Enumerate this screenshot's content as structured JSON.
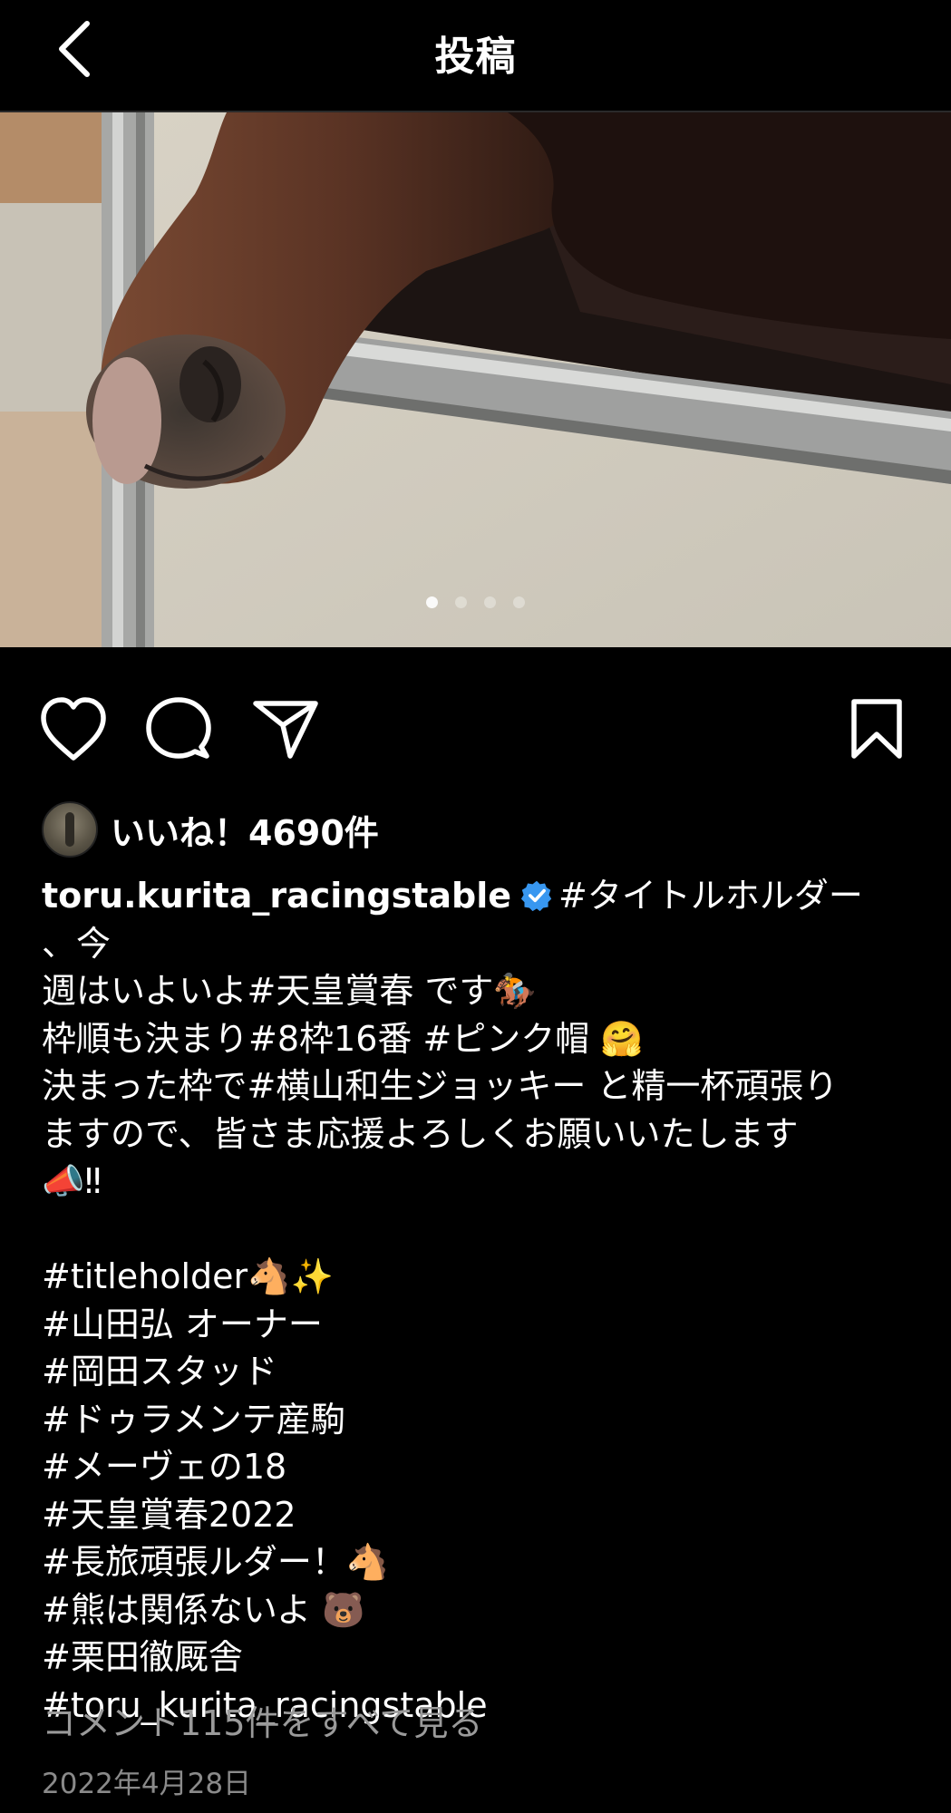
{
  "header": {
    "title": "投稿"
  },
  "post": {
    "image_dots": 4,
    "active_dot": 0,
    "likes_text": "いいね！4690件",
    "username": "toru.kurita_racingstable",
    "caption_lines": [
      "#タイトルホルダー 、今",
      "週はいよいよ#天皇賞春 です🏇",
      "枠順も決まり#8枠16番 #ピンク帽 🤗",
      "決まった枠で#横山和生ジョッキー と精一杯頑張り",
      "ますので、皆さま応援よろしくお願いいたします",
      "📣‼",
      "",
      "#titleholder🐴✨",
      "#山田弘 オーナー",
      "#岡田スタッド",
      "#ドゥラメンテ産駒",
      "#メーヴェの18",
      "#天皇賞春2022",
      "#長旅頑張ルダー！🐴",
      "#熊は関係ないよ 🐻",
      "#栗田徹厩舎",
      "#toru_kurita_racingstable"
    ],
    "view_comments": "コメント115件をすべて見る",
    "date": "2022年4月28日"
  },
  "icons": {
    "back": "chevron-left-icon",
    "like": "heart-icon",
    "comment": "comment-bubble-icon",
    "share": "paper-plane-icon",
    "save": "bookmark-icon",
    "verified": "verified-badge-icon"
  },
  "colors": {
    "background": "#000000",
    "text": "#ffffff",
    "muted": "#9a9a9a",
    "verified": "#3897f0"
  }
}
